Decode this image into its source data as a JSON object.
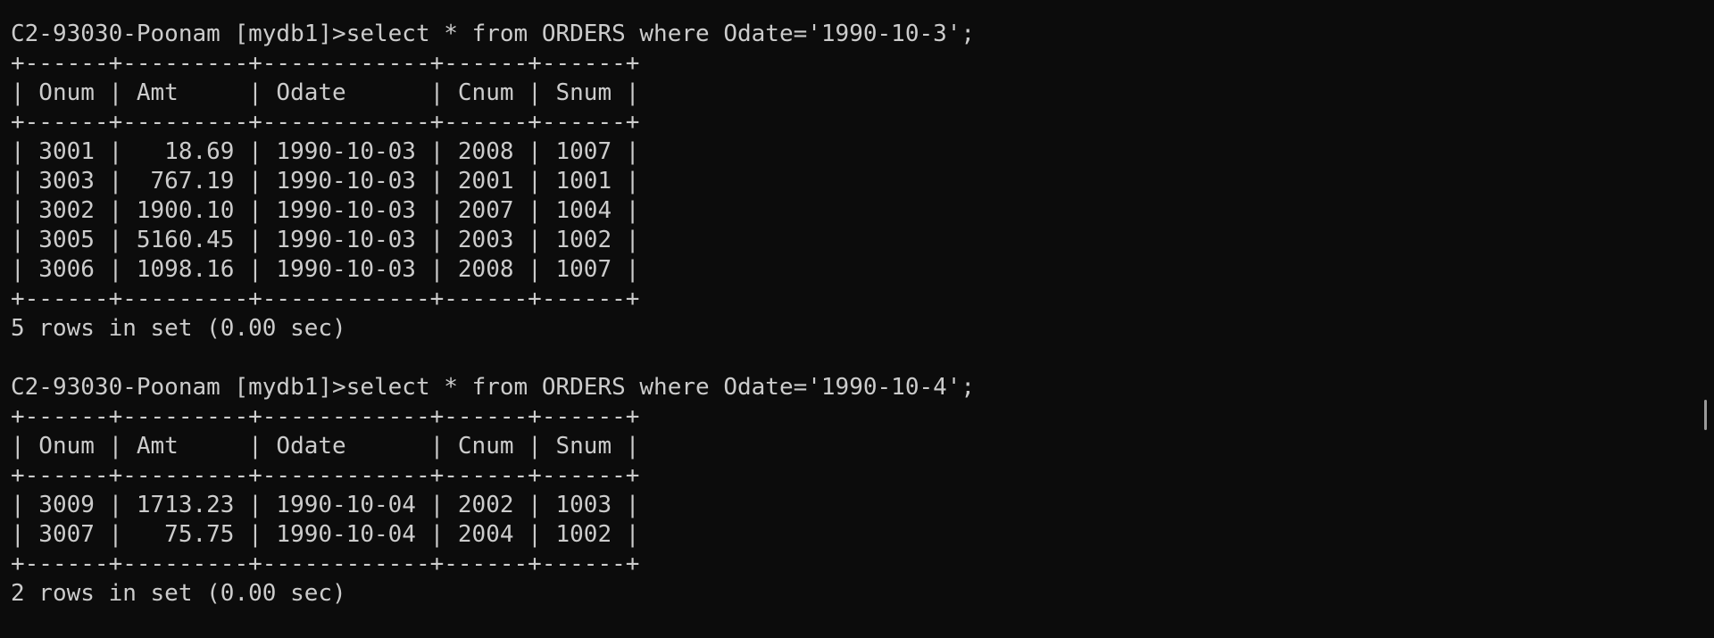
{
  "terminal": {
    "queries": [
      {
        "prompt": "C2-93030-Poonam [mydb1]>",
        "command": "select * from ORDERS where Odate='1990-10-3';",
        "table": {
          "border": "+------+---------+------------+------+------+",
          "header": "| Onum | Amt     | Odate      | Cnum | Snum |",
          "rows": [
            "| 3001 |   18.69 | 1990-10-03 | 2008 | 1007 |",
            "| 3003 |  767.19 | 1990-10-03 | 2001 | 1001 |",
            "| 3002 | 1900.10 | 1990-10-03 | 2007 | 1004 |",
            "| 3005 | 5160.45 | 1990-10-03 | 2003 | 1002 |",
            "| 3006 | 1098.16 | 1990-10-03 | 2008 | 1007 |"
          ]
        },
        "result": "5 rows in set (0.00 sec)"
      },
      {
        "prompt": "C2-93030-Poonam [mydb1]>",
        "command": "select * from ORDERS where Odate='1990-10-4';",
        "table": {
          "border": "+------+---------+------------+------+------+",
          "header": "| Onum | Amt     | Odate      | Cnum | Snum |",
          "rows": [
            "| 3009 | 1713.23 | 1990-10-04 | 2002 | 1003 |",
            "| 3007 |   75.75 | 1990-10-04 | 2004 | 1002 |"
          ]
        },
        "result": "2 rows in set (0.00 sec)"
      }
    ]
  },
  "colors": {
    "background": "#0c0c0c",
    "text": "#cccccc",
    "scrollbar": "#9a9a9a"
  }
}
